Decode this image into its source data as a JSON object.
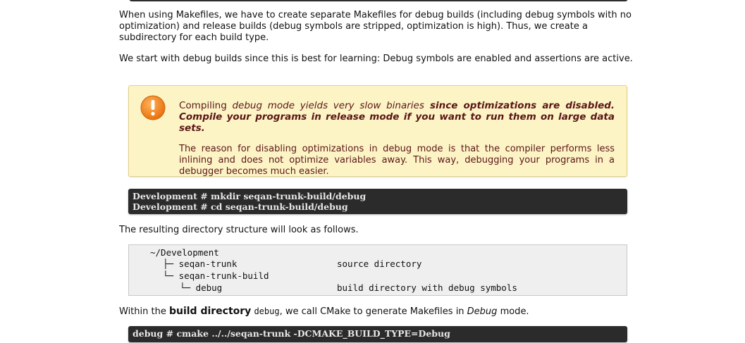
{
  "intro": {
    "p1": "When using Makefiles, we have to create separate Makefiles for debug builds (including debug symbols with no optimization) and release builds (debug symbols are stripped, optimization is high). Thus, we create a subdirectory for each build type.",
    "p2": "We start with debug builds since this is best for learning: Debug symbols are enabled and assertions are active."
  },
  "warning": {
    "icon": "exclamation-icon",
    "line1_a": "Compiling ",
    "line1_b": "debug mode yields very slow binaries",
    "line1_c": " since optimizations are disabled. Compile your programs in release mode if you want to run them on large data sets.",
    "p2": "The reason for disabling optimizations in debug mode is that the compiler performs less inlining and does not optimize variables away. This way, debugging your programs in a debugger becomes much easier."
  },
  "code1": {
    "line1": "Development # mkdir seqan-trunk-build/debug",
    "line2": "Development # cd seqan-trunk-build/debug"
  },
  "p3": "The resulting directory structure will look as follows.",
  "tree": {
    "root": "~/Development",
    "row1": "├─ seqan-trunk",
    "row1_desc": "source directory",
    "row2": "└─ seqan-trunk-build",
    "row3": "└─ debug",
    "row3_desc": "build directory with debug symbols"
  },
  "p4": {
    "a": "Within the ",
    "b": "build directory",
    "c": "debug",
    "d": ", we call CMake to generate Makefiles in ",
    "e": "Debug",
    "f": " mode."
  },
  "code2": {
    "line1": "debug # cmake ../../seqan-trunk -DCMAKE_BUILD_TYPE=Debug"
  },
  "colors": {
    "warning_bg": "#fdf4c6",
    "warning_text": "#5a1616",
    "warning_icon": "#f08a1c",
    "code_bg": "#2b2b2b"
  }
}
